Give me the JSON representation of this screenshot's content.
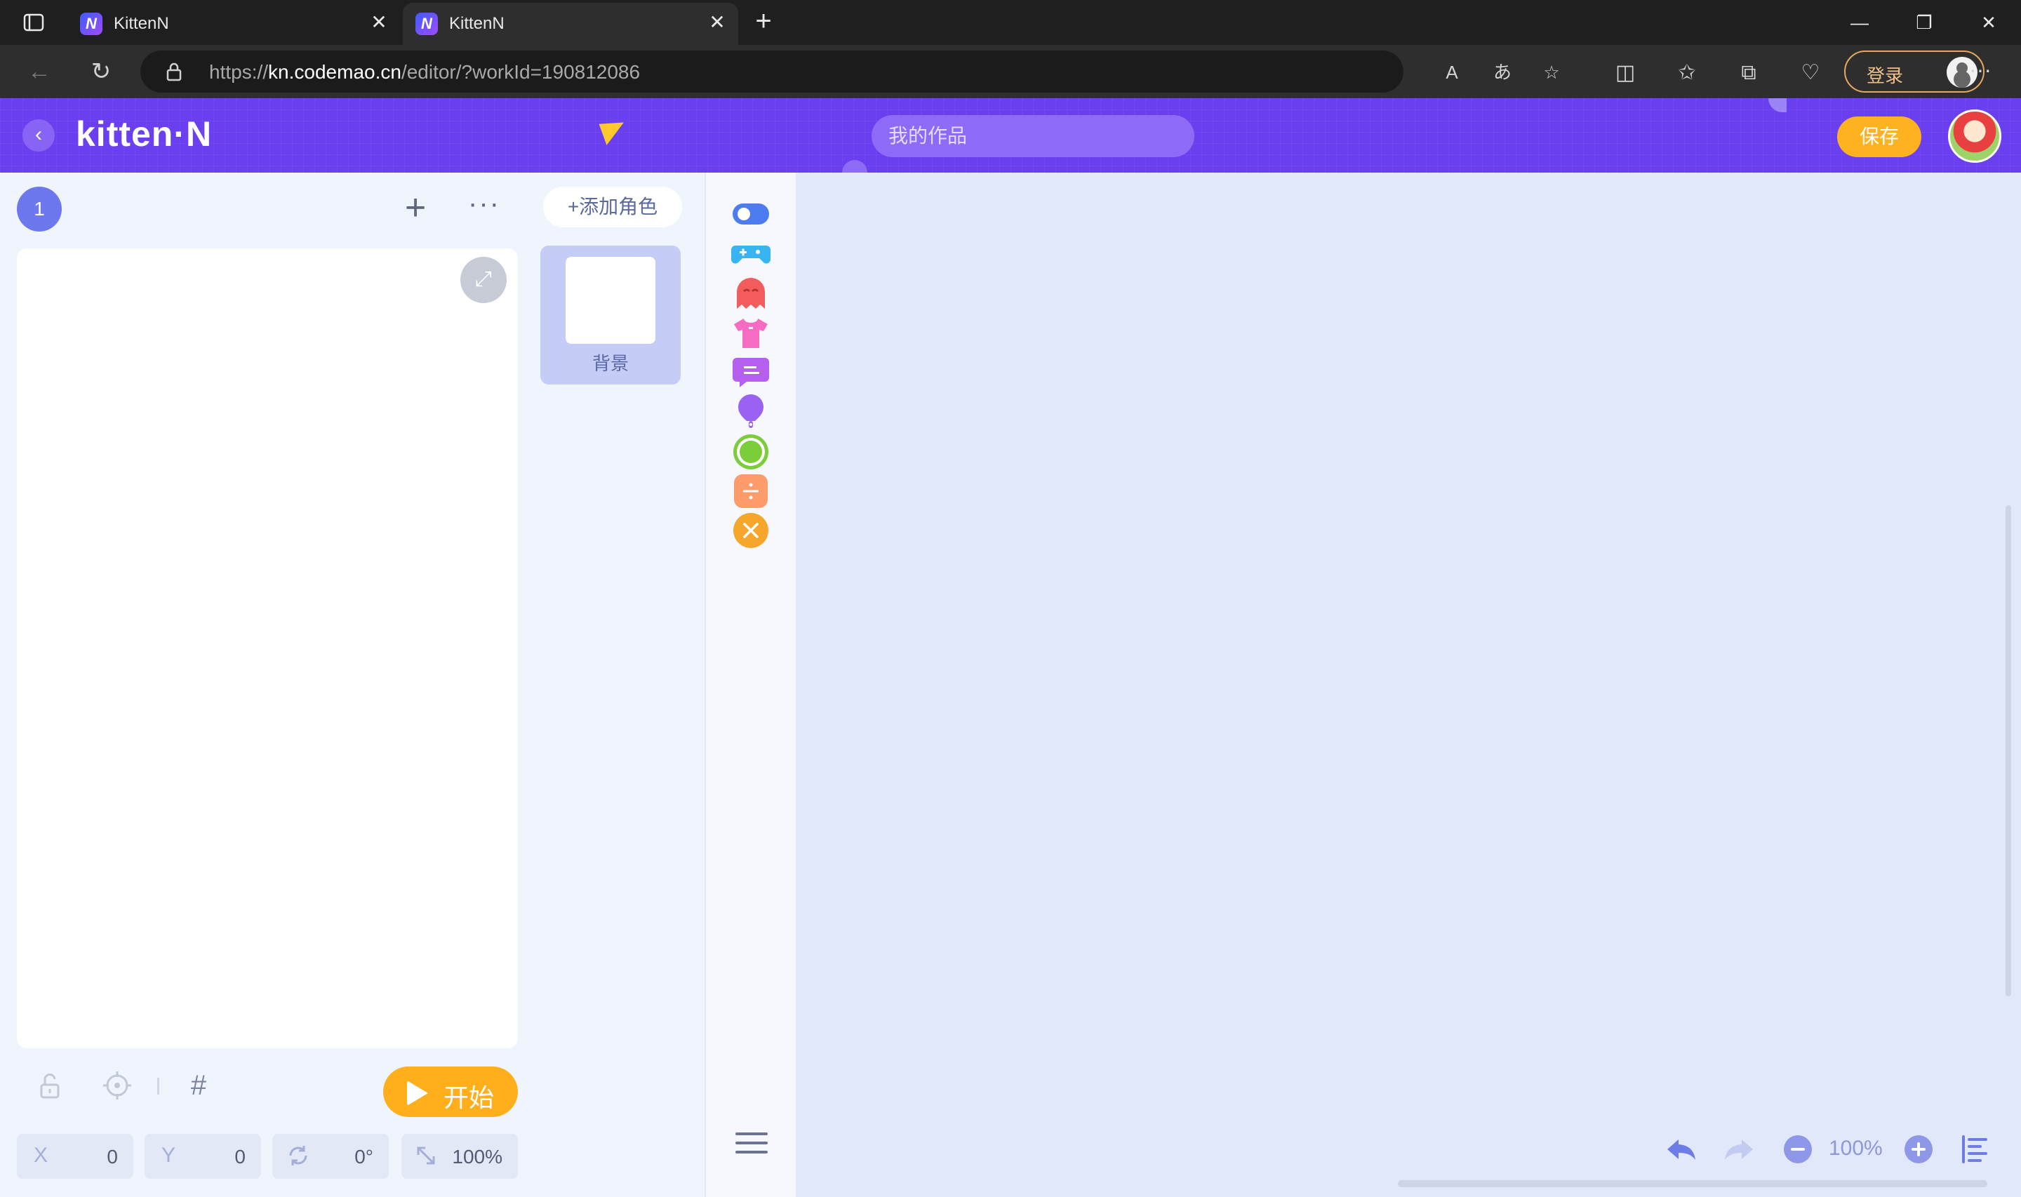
{
  "browser": {
    "tabs": [
      {
        "title": "KittenN",
        "favicon": "N"
      },
      {
        "title": "KittenN",
        "favicon": "N"
      }
    ],
    "url_prefix": "https://",
    "url_host": "kn.codemao.cn",
    "url_path": "/editor/?workId=190812086",
    "login_label": "登录"
  },
  "header": {
    "logo": "kitten·N",
    "work_name_placeholder": "我的作品",
    "save_label": "保存"
  },
  "stage": {
    "scene_number": "1",
    "run_label": "开始",
    "props": [
      {
        "key": "X",
        "value": "0"
      },
      {
        "key": "Y",
        "value": "0"
      },
      {
        "key": "rotation-icon",
        "value": "0°"
      },
      {
        "key": "scale-icon",
        "value": "100%"
      }
    ]
  },
  "sprites": {
    "add_label": "+添加角色",
    "items": [
      {
        "name": "背景"
      }
    ]
  },
  "categories": [
    {
      "name": "event-icon",
      "color": "#4c7cf0"
    },
    {
      "name": "control-icon",
      "color": "#39b4f3"
    },
    {
      "name": "action-icon",
      "color": "#f25c5c"
    },
    {
      "name": "appearance-icon",
      "color": "#f56cc2"
    },
    {
      "name": "dialogue-icon",
      "color": "#b45ff0"
    },
    {
      "name": "sound-icon",
      "color": "#9a62f2"
    },
    {
      "name": "sensing-icon",
      "color": "#7ccd3a"
    },
    {
      "name": "operator-icon",
      "color": "#fd9b6b"
    },
    {
      "name": "variable-icon",
      "color": "#f6a62b"
    }
  ],
  "code": {
    "zoom": "100%"
  },
  "colors": {
    "brand": "#6a3fef",
    "save": "#ffb21f",
    "run": "#ffaf1c",
    "workspace": "#e1e8fa"
  }
}
